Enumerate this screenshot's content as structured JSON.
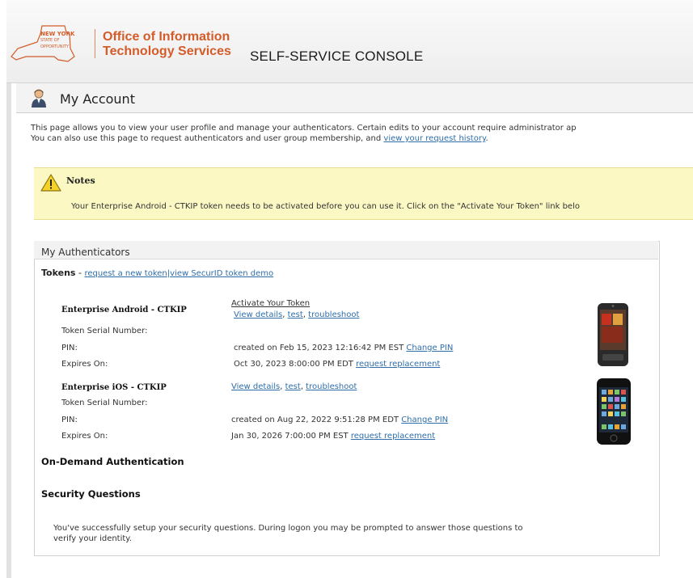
{
  "header": {
    "logo_line1": "NEW YORK",
    "logo_line2": "STATE OF",
    "logo_line3": "OPPORTUNITY",
    "office_line1": "Office of Information",
    "office_line2": "Technology Services",
    "console_title": "SELF-SERVICE CONSOLE"
  },
  "page": {
    "title": "My Account",
    "intro_line1": "This page allows you to view your user profile and manage your authenticators. Certain edits to your account require administrator ap",
    "intro_line2_prefix": "You can also use this page to request authenticators and user group membership, and ",
    "intro_link": "view your request history",
    "intro_suffix": "."
  },
  "notes": {
    "title": "Notes",
    "message": "Your Enterprise Android - CTKIP token needs to be activated before you can use it. Click on the \"Activate Your Token\" link belo"
  },
  "authenticators": {
    "title": "My Authenticators",
    "tokens_label": "Tokens",
    "tokens_dash": " - ",
    "request_token_link": "request a new token",
    "separator": "|",
    "demo_link": "view SecurID token demo",
    "tokens": [
      {
        "name": "Enterprise Android - CTKIP",
        "activate_link": "Activate Your Token",
        "view_details": "View details",
        "test": "test",
        "troubleshoot": "troubleshoot",
        "serial_label": "Token Serial Number:",
        "pin_label": "PIN:",
        "pin_value": "created on Feb 15, 2023 12:16:42 PM EST",
        "change_pin": "Change PIN",
        "expires_label": "Expires On:",
        "expires_value": "Oct 30, 2023 8:00:00 PM EDT",
        "request_replacement": "request replacement"
      },
      {
        "name": "Enterprise iOS - CTKIP",
        "view_details": "View details",
        "test": "test",
        "troubleshoot": "troubleshoot",
        "serial_label": "Token Serial Number:",
        "pin_label": "PIN:",
        "pin_value": "created on Aug 22, 2022 9:51:28 PM EDT",
        "change_pin": "Change PIN",
        "expires_label": "Expires On:",
        "expires_value": "Jan 30, 2026 7:00:00 PM EST",
        "request_replacement": "request replacement"
      }
    ],
    "on_demand_title": "On-Demand Authentication",
    "security_title": "Security Questions",
    "security_line1": "You've successfully setup your security questions. During logon you may be prompted to answer those questions to",
    "security_line2": "verify your identity."
  },
  "colors": {
    "brand_orange": "#d35c2a",
    "link_blue": "#2f6ea8",
    "notes_bg": "#fbf8c4"
  },
  "icons": [
    "ny-state-map-icon",
    "user-icon",
    "warning-icon",
    "android-phone-icon",
    "iphone-icon"
  ]
}
